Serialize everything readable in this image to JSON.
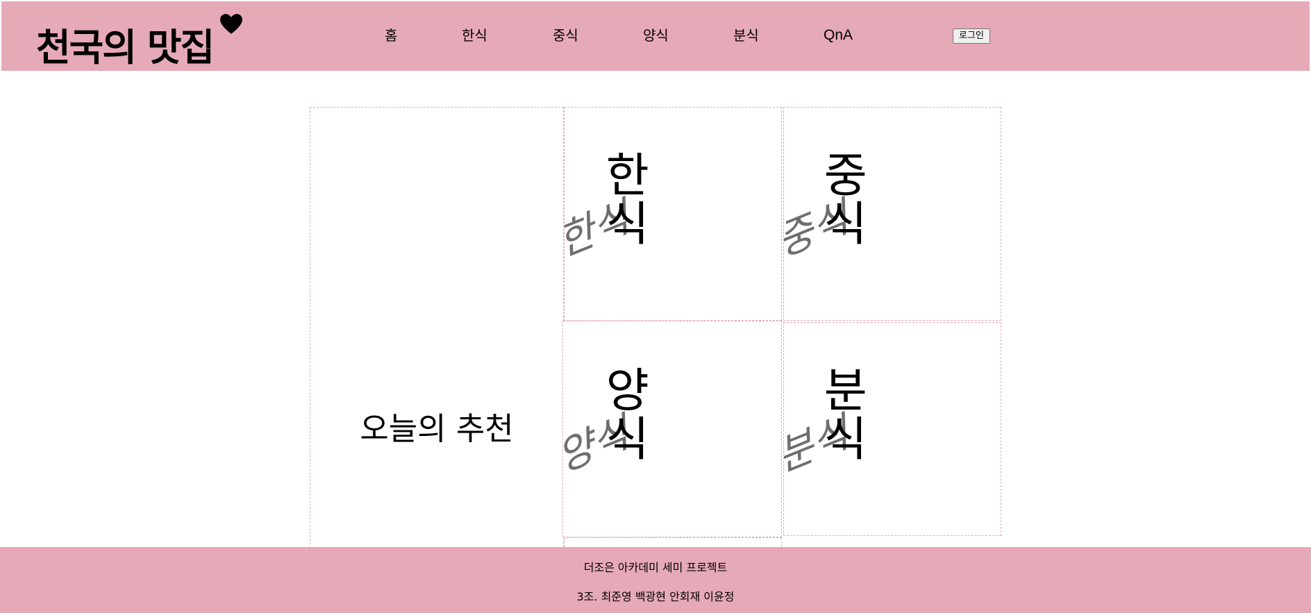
{
  "header": {
    "logo": "천국의 맛집",
    "logo_icon": "heart-icon",
    "nav": [
      {
        "label": "홈"
      },
      {
        "label": "한식"
      },
      {
        "label": "중식"
      },
      {
        "label": "양식"
      },
      {
        "label": "분식"
      },
      {
        "label": "QnA"
      }
    ],
    "login_label": "로그인"
  },
  "main": {
    "recommend_label": "오늘의 추천",
    "cards": [
      {
        "line1": "한",
        "line2": "식",
        "shadow": "한식"
      },
      {
        "line1": "중",
        "line2": "식",
        "shadow": "중식"
      },
      {
        "line1": "양",
        "line2": "식",
        "shadow": "양식"
      },
      {
        "line1": "분",
        "line2": "식",
        "shadow": "분식"
      }
    ]
  },
  "footer": {
    "line1": "더조은 아카데미 세미 프로젝트",
    "line2": "3조. 최준영 백광현 안회재 이윤정"
  },
  "colors": {
    "header_bg": "#e6a9b8",
    "footer_bg": "#e6a9b8",
    "cell_border": "#e6a9b8",
    "shadow_text": "#6e6e6e"
  }
}
